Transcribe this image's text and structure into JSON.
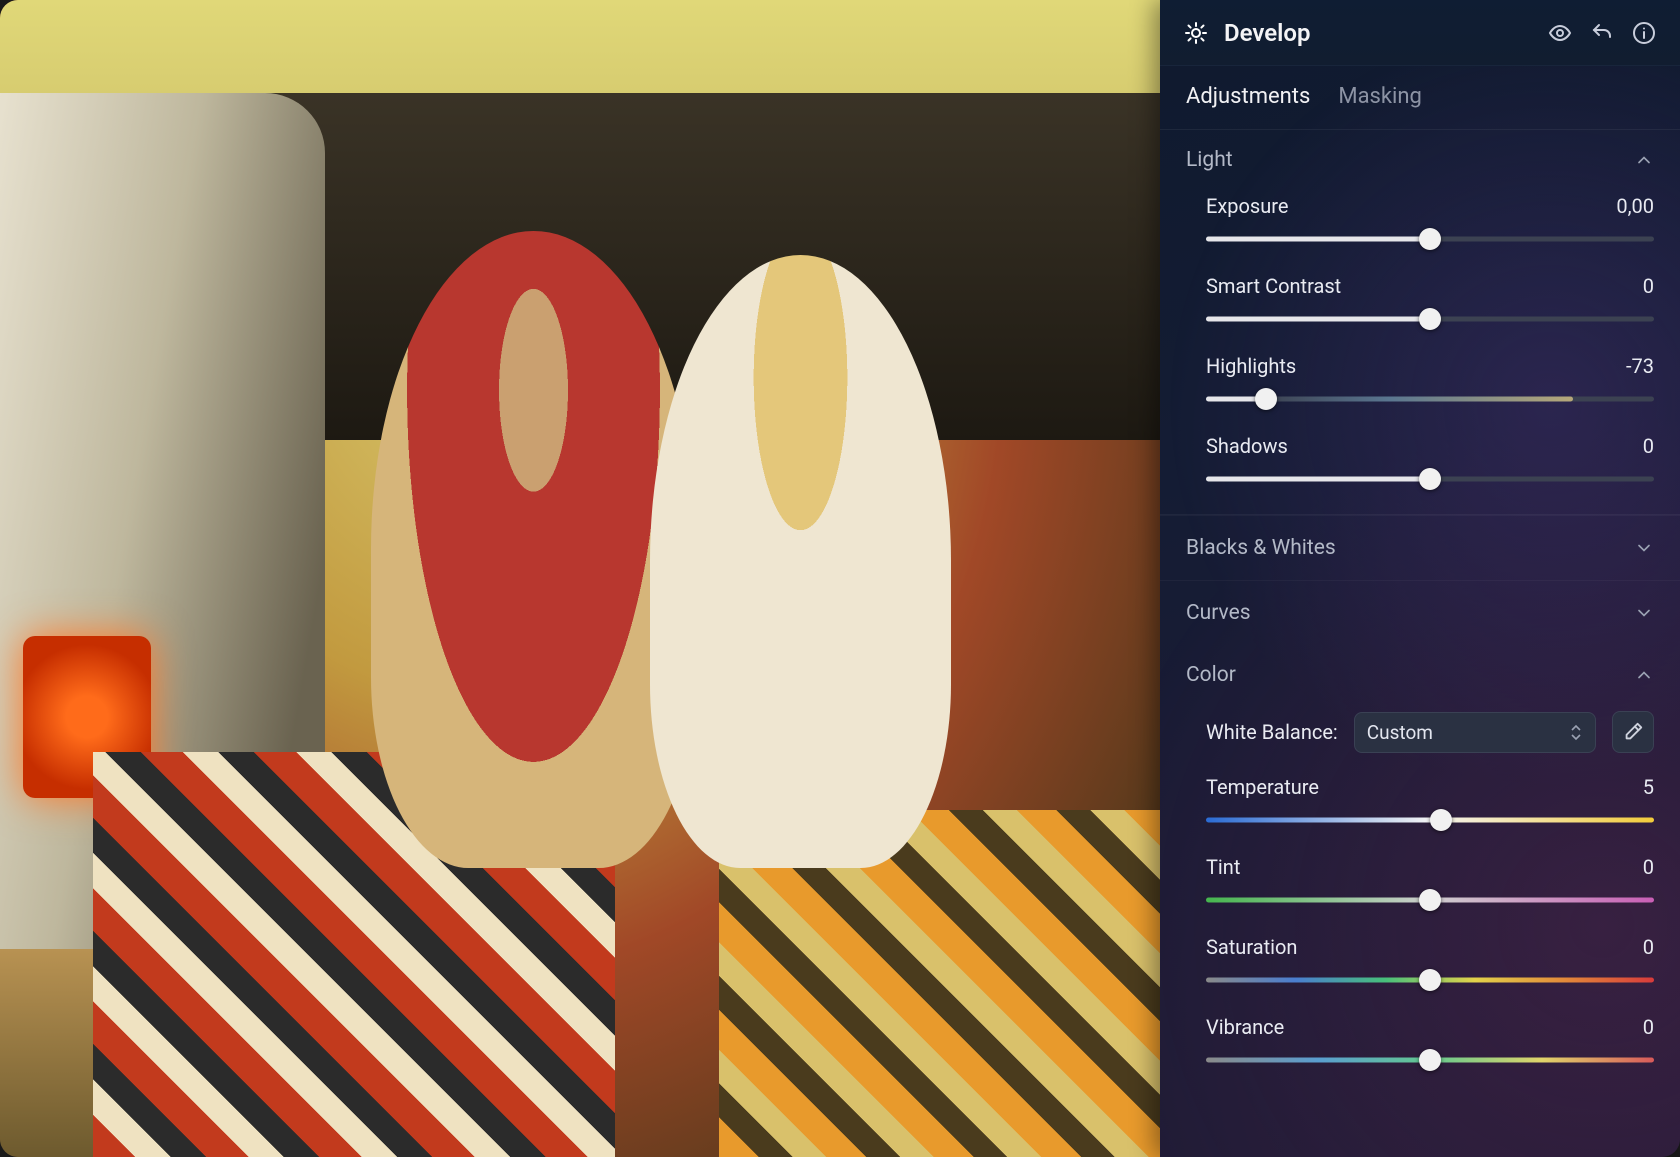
{
  "header": {
    "title": "Develop"
  },
  "tabs": {
    "adjustments": "Adjustments",
    "masking": "Masking",
    "active": "adjustments"
  },
  "sections": {
    "light": {
      "title": "Light",
      "expanded": true,
      "controls": {
        "exposure": {
          "label": "Exposure",
          "value": "0,00",
          "percent": 50
        },
        "smartContrast": {
          "label": "Smart Contrast",
          "value": "0",
          "percent": 50
        },
        "highlights": {
          "label": "Highlights",
          "value": "-73",
          "percent": 13.5
        },
        "shadows": {
          "label": "Shadows",
          "value": "0",
          "percent": 50
        }
      }
    },
    "blacksWhites": {
      "title": "Blacks & Whites",
      "expanded": false
    },
    "curves": {
      "title": "Curves",
      "expanded": false
    },
    "color": {
      "title": "Color",
      "expanded": true,
      "whiteBalance": {
        "label": "White Balance:",
        "selected": "Custom"
      },
      "controls": {
        "temperature": {
          "label": "Temperature",
          "value": "5",
          "percent": 52.5
        },
        "tint": {
          "label": "Tint",
          "value": "0",
          "percent": 50
        },
        "saturation": {
          "label": "Saturation",
          "value": "0",
          "percent": 50
        },
        "vibrance": {
          "label": "Vibrance",
          "value": "0",
          "percent": 50
        }
      }
    }
  },
  "icons": {
    "develop": "sun",
    "preview": "eye",
    "undo": "undo",
    "info": "info"
  }
}
